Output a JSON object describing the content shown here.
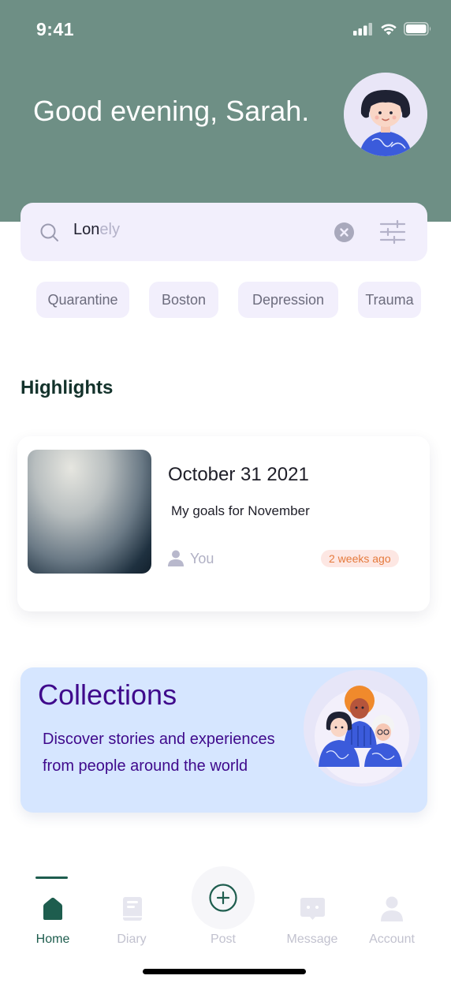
{
  "status_bar": {
    "time": "9:41"
  },
  "header": {
    "greeting": "Good evening, Sarah."
  },
  "search": {
    "typed": "Lon",
    "suggestion": "ely"
  },
  "chips": [
    "Quarantine",
    "Boston",
    "Depression",
    "Trauma"
  ],
  "highlights": {
    "title": "Highlights",
    "card": {
      "date": "October 31 2021",
      "title": "My goals for November",
      "author": "You",
      "time_ago": "2 weeks ago"
    }
  },
  "collections": {
    "title": "Collections",
    "description": "Discover stories and experiences from people around the world"
  },
  "nav": {
    "items": [
      {
        "label": "Home",
        "icon": "home-icon",
        "active": true
      },
      {
        "label": "Diary",
        "icon": "book-icon",
        "active": false
      },
      {
        "label": "Post",
        "icon": "plus-circle-icon",
        "active": false
      },
      {
        "label": "Message",
        "icon": "message-icon",
        "active": false
      },
      {
        "label": "Account",
        "icon": "user-icon",
        "active": false
      }
    ]
  },
  "colors": {
    "header_bg": "#6e8f85",
    "accent_green": "#1e5d4e",
    "chip_bg": "#f2effc",
    "collections_bg": "#d6e6ff",
    "collections_text": "#3f0a8c",
    "badge_text": "#e57a3c"
  }
}
